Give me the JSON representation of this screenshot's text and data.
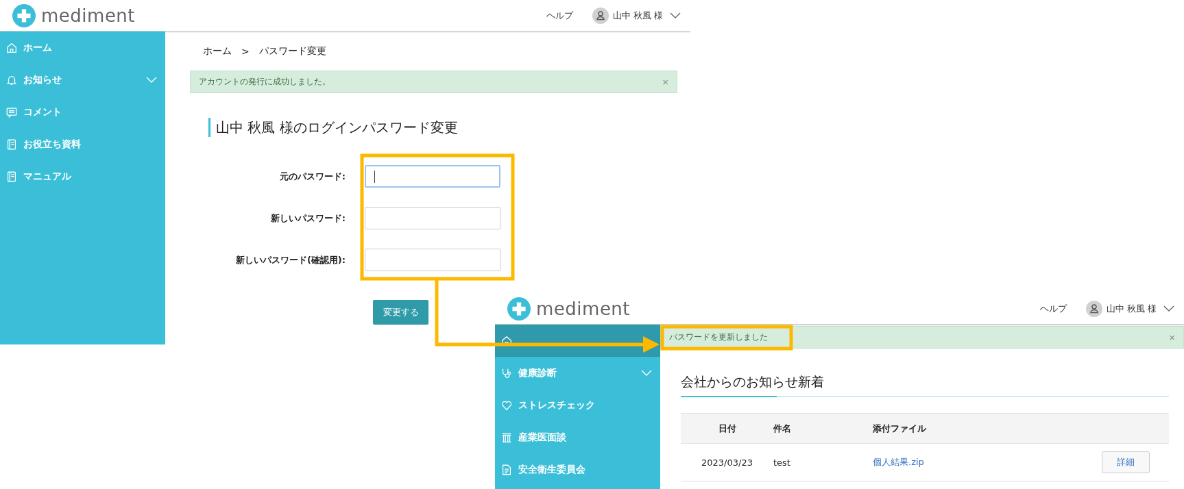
{
  "screen_password": {
    "header": {
      "logo": "mediment",
      "help": "ヘルプ",
      "user": "山中 秋風 様"
    },
    "sidebar": [
      {
        "label": "ホーム",
        "selected": false,
        "expandable": false
      },
      {
        "label": "お知らせ",
        "selected": false,
        "expandable": true
      },
      {
        "label": "コメント",
        "selected": false,
        "expandable": false
      },
      {
        "label": "お役立ち資料",
        "selected": false,
        "expandable": false
      },
      {
        "label": "マニュアル",
        "selected": false,
        "expandable": false
      }
    ],
    "breadcrumb": {
      "items": [
        "ホーム",
        "パスワード変更"
      ],
      "separator": ">"
    },
    "alert": {
      "message": "アカウントの発行に成功しました。",
      "close": "×"
    },
    "form": {
      "title": "山中 秋風 様のログインパスワード変更",
      "fields": [
        {
          "label": "元のパスワード:",
          "focused": true
        },
        {
          "label": "新しいパスワード:",
          "focused": false
        },
        {
          "label": "新しいパスワード(確認用):",
          "focused": false
        }
      ],
      "submit": "変更する"
    }
  },
  "screen_home": {
    "header": {
      "logo": "mediment",
      "help": "ヘルプ",
      "user": "山中 秋風 様"
    },
    "sidebar": [
      {
        "selected": true,
        "expandable": false
      },
      {
        "label": "健康診断",
        "selected": false,
        "expandable": true
      },
      {
        "label": "ストレスチェック",
        "selected": false,
        "expandable": false
      },
      {
        "label": "産業医面談",
        "selected": false,
        "expandable": false
      },
      {
        "label": "安全衛生委員会",
        "selected": false,
        "expandable": false
      }
    ],
    "alert": {
      "message": "パスワードを更新しました",
      "close": "×"
    },
    "news": {
      "title": "会社からのお知らせ新着",
      "columns": [
        "日付",
        "件名",
        "添付ファイル"
      ],
      "rows": [
        {
          "date": "2023/03/23",
          "subject": "test",
          "attachment": "個人結果.zip",
          "action": "詳細"
        }
      ]
    }
  }
}
